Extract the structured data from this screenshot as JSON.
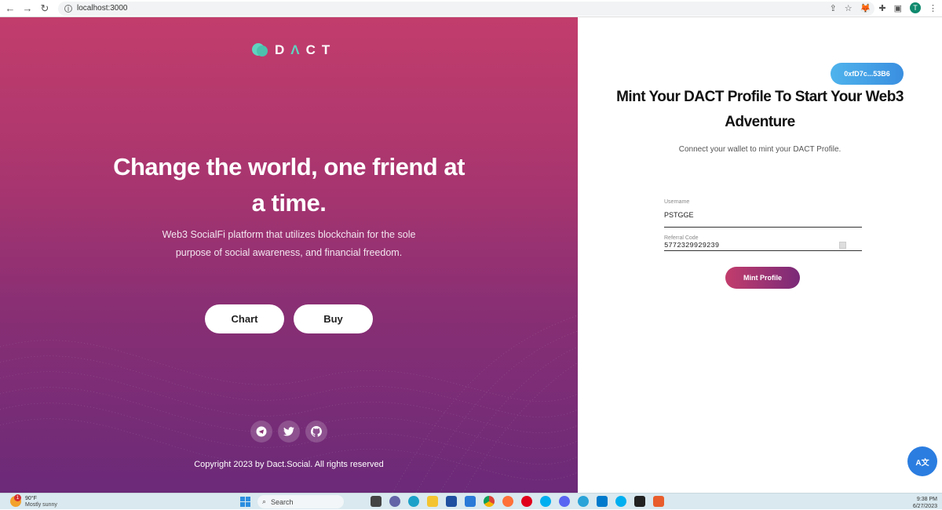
{
  "browser": {
    "url": "localhost:3000",
    "profile_initial": "T"
  },
  "left": {
    "logo_text_1": "D",
    "logo_text_2": "Λ",
    "logo_text_3": "CT",
    "hero_title_line1": "Change the world, one friend at",
    "hero_title_line2": "a time.",
    "hero_sub_line1": "Web3 SocialFi platform that utilizes blockchain for the sole",
    "hero_sub_line2": "purpose of social awareness, and financial freedom.",
    "chart_button": "Chart",
    "buy_button": "Buy",
    "socials": [
      "telegram-icon",
      "twitter-icon",
      "github-icon"
    ],
    "copyright": "Copyright 2023 by Dact.Social. All rights reserved",
    "gradient_top": "#c23d6c",
    "gradient_bottom": "#6b2a78"
  },
  "right": {
    "wallet_address": "0xfD7c...53B6",
    "title_line1": "Mint Your DACT Profile To Start Your Web3",
    "title_line2": "Adventure",
    "subtitle": "Connect your wallet to mint your DACT Profile.",
    "username_label": "Username",
    "username_value": "PSTGGE",
    "referral_label": "Referral Code",
    "referral_value": "5772329929239",
    "mint_button": "Mint Profile",
    "translate_icon_label": "A文"
  },
  "taskbar": {
    "weather_temp": "90°F",
    "weather_desc": "Mostly sunny",
    "weather_badge": "1",
    "search_placeholder": "Search",
    "time": "9:38 PM",
    "date": "6/27/2023"
  }
}
